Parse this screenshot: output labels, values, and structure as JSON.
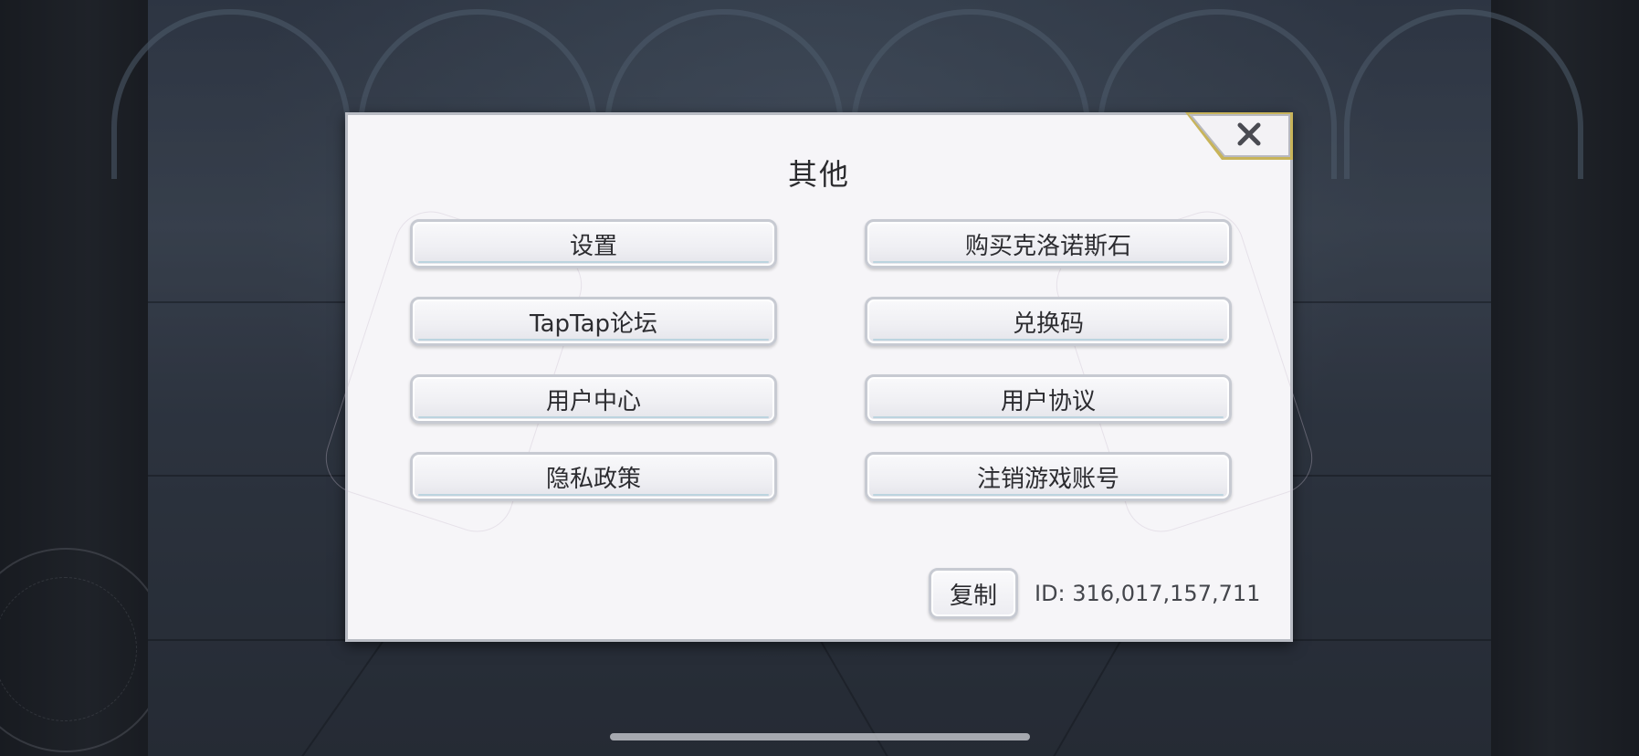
{
  "dialog": {
    "title": "其他",
    "close_icon": "close-icon"
  },
  "menu": {
    "left": [
      {
        "label": "设置"
      },
      {
        "label": "TapTap论坛"
      },
      {
        "label": "用户中心"
      },
      {
        "label": "隐私政策"
      }
    ],
    "right": [
      {
        "label": "购买克洛诺斯石"
      },
      {
        "label": "兑换码"
      },
      {
        "label": "用户协议"
      },
      {
        "label": "注销游戏账号"
      }
    ]
  },
  "footer": {
    "copy_label": "复制",
    "id_text": "ID: 316,017,157,711"
  },
  "colors": {
    "dialog_bg": "#f6f5f8",
    "button_border": "#c7cad2",
    "close_accent": "#c8b45a",
    "text": "#2c2c30"
  }
}
